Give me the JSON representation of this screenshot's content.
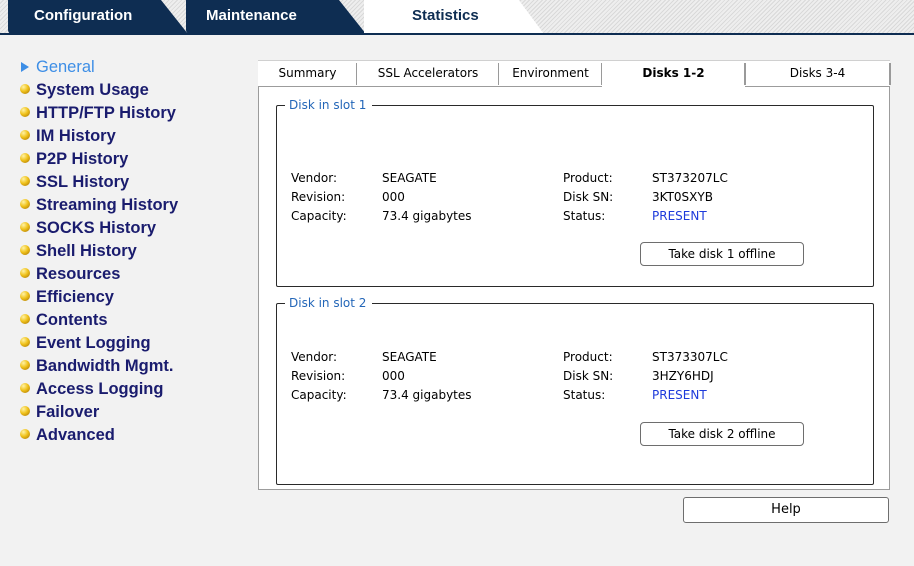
{
  "top_tabs": [
    "Configuration",
    "Maintenance",
    "Statistics"
  ],
  "nav": {
    "active": "General",
    "items": [
      "System Usage",
      "HTTP/FTP History",
      "IM History",
      "P2P History",
      "SSL History",
      "Streaming History",
      "SOCKS History",
      "Shell History",
      "Resources",
      "Efficiency",
      "Contents",
      "Event Logging",
      "Bandwidth Mgmt.",
      "Access Logging",
      "Failover",
      "Advanced"
    ]
  },
  "sub_tabs": [
    "Summary",
    "SSL Accelerators",
    "Environment",
    "Disks 1-2",
    "Disks 3-4"
  ],
  "labels": {
    "vendor": "Vendor:",
    "revision": "Revision:",
    "capacity": "Capacity:",
    "product": "Product:",
    "disk_sn": "Disk SN:",
    "status": "Status:"
  },
  "disks": [
    {
      "title": "Disk in slot 1",
      "vendor": "SEAGATE",
      "revision": "000",
      "capacity": "73.4 gigabytes",
      "product": "ST373207LC",
      "disk_sn": "3KT0SXYB",
      "status": "PRESENT",
      "button": "Take disk 1 offline"
    },
    {
      "title": "Disk in slot 2",
      "vendor": "SEAGATE",
      "revision": "000",
      "capacity": "73.4 gigabytes",
      "product": "ST373307LC",
      "disk_sn": "3HZY6HDJ",
      "status": "PRESENT",
      "button": "Take disk 2 offline"
    }
  ],
  "help_label": "Help",
  "colors": {
    "tab_dark": "#0e2d52",
    "nav_text": "#1a1c6e",
    "nav_active": "#3d8ee6",
    "group_title": "#2366b8",
    "status_present": "#1d3adb"
  },
  "icons": {
    "nav_bullet": "yellow-ball-icon",
    "nav_active": "right-arrow-icon"
  }
}
